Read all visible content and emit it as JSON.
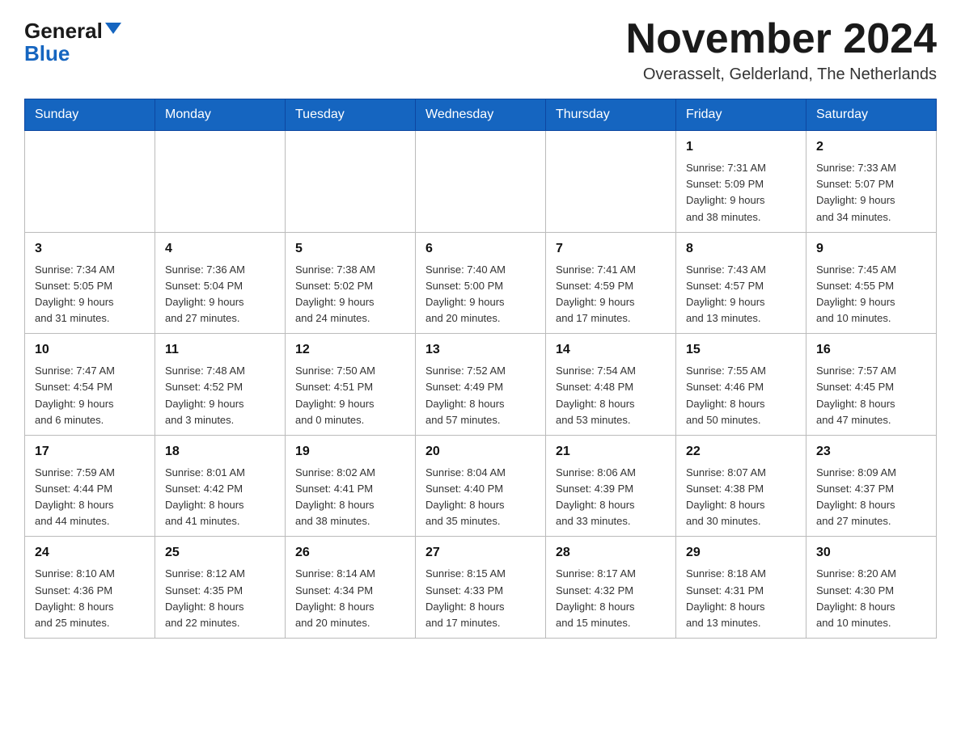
{
  "header": {
    "logo_general": "General",
    "logo_blue": "Blue",
    "month_title": "November 2024",
    "location": "Overasselt, Gelderland, The Netherlands"
  },
  "weekdays": [
    "Sunday",
    "Monday",
    "Tuesday",
    "Wednesday",
    "Thursday",
    "Friday",
    "Saturday"
  ],
  "weeks": [
    [
      {
        "day": "",
        "info": ""
      },
      {
        "day": "",
        "info": ""
      },
      {
        "day": "",
        "info": ""
      },
      {
        "day": "",
        "info": ""
      },
      {
        "day": "",
        "info": ""
      },
      {
        "day": "1",
        "info": "Sunrise: 7:31 AM\nSunset: 5:09 PM\nDaylight: 9 hours\nand 38 minutes."
      },
      {
        "day": "2",
        "info": "Sunrise: 7:33 AM\nSunset: 5:07 PM\nDaylight: 9 hours\nand 34 minutes."
      }
    ],
    [
      {
        "day": "3",
        "info": "Sunrise: 7:34 AM\nSunset: 5:05 PM\nDaylight: 9 hours\nand 31 minutes."
      },
      {
        "day": "4",
        "info": "Sunrise: 7:36 AM\nSunset: 5:04 PM\nDaylight: 9 hours\nand 27 minutes."
      },
      {
        "day": "5",
        "info": "Sunrise: 7:38 AM\nSunset: 5:02 PM\nDaylight: 9 hours\nand 24 minutes."
      },
      {
        "day": "6",
        "info": "Sunrise: 7:40 AM\nSunset: 5:00 PM\nDaylight: 9 hours\nand 20 minutes."
      },
      {
        "day": "7",
        "info": "Sunrise: 7:41 AM\nSunset: 4:59 PM\nDaylight: 9 hours\nand 17 minutes."
      },
      {
        "day": "8",
        "info": "Sunrise: 7:43 AM\nSunset: 4:57 PM\nDaylight: 9 hours\nand 13 minutes."
      },
      {
        "day": "9",
        "info": "Sunrise: 7:45 AM\nSunset: 4:55 PM\nDaylight: 9 hours\nand 10 minutes."
      }
    ],
    [
      {
        "day": "10",
        "info": "Sunrise: 7:47 AM\nSunset: 4:54 PM\nDaylight: 9 hours\nand 6 minutes."
      },
      {
        "day": "11",
        "info": "Sunrise: 7:48 AM\nSunset: 4:52 PM\nDaylight: 9 hours\nand 3 minutes."
      },
      {
        "day": "12",
        "info": "Sunrise: 7:50 AM\nSunset: 4:51 PM\nDaylight: 9 hours\nand 0 minutes."
      },
      {
        "day": "13",
        "info": "Sunrise: 7:52 AM\nSunset: 4:49 PM\nDaylight: 8 hours\nand 57 minutes."
      },
      {
        "day": "14",
        "info": "Sunrise: 7:54 AM\nSunset: 4:48 PM\nDaylight: 8 hours\nand 53 minutes."
      },
      {
        "day": "15",
        "info": "Sunrise: 7:55 AM\nSunset: 4:46 PM\nDaylight: 8 hours\nand 50 minutes."
      },
      {
        "day": "16",
        "info": "Sunrise: 7:57 AM\nSunset: 4:45 PM\nDaylight: 8 hours\nand 47 minutes."
      }
    ],
    [
      {
        "day": "17",
        "info": "Sunrise: 7:59 AM\nSunset: 4:44 PM\nDaylight: 8 hours\nand 44 minutes."
      },
      {
        "day": "18",
        "info": "Sunrise: 8:01 AM\nSunset: 4:42 PM\nDaylight: 8 hours\nand 41 minutes."
      },
      {
        "day": "19",
        "info": "Sunrise: 8:02 AM\nSunset: 4:41 PM\nDaylight: 8 hours\nand 38 minutes."
      },
      {
        "day": "20",
        "info": "Sunrise: 8:04 AM\nSunset: 4:40 PM\nDaylight: 8 hours\nand 35 minutes."
      },
      {
        "day": "21",
        "info": "Sunrise: 8:06 AM\nSunset: 4:39 PM\nDaylight: 8 hours\nand 33 minutes."
      },
      {
        "day": "22",
        "info": "Sunrise: 8:07 AM\nSunset: 4:38 PM\nDaylight: 8 hours\nand 30 minutes."
      },
      {
        "day": "23",
        "info": "Sunrise: 8:09 AM\nSunset: 4:37 PM\nDaylight: 8 hours\nand 27 minutes."
      }
    ],
    [
      {
        "day": "24",
        "info": "Sunrise: 8:10 AM\nSunset: 4:36 PM\nDaylight: 8 hours\nand 25 minutes."
      },
      {
        "day": "25",
        "info": "Sunrise: 8:12 AM\nSunset: 4:35 PM\nDaylight: 8 hours\nand 22 minutes."
      },
      {
        "day": "26",
        "info": "Sunrise: 8:14 AM\nSunset: 4:34 PM\nDaylight: 8 hours\nand 20 minutes."
      },
      {
        "day": "27",
        "info": "Sunrise: 8:15 AM\nSunset: 4:33 PM\nDaylight: 8 hours\nand 17 minutes."
      },
      {
        "day": "28",
        "info": "Sunrise: 8:17 AM\nSunset: 4:32 PM\nDaylight: 8 hours\nand 15 minutes."
      },
      {
        "day": "29",
        "info": "Sunrise: 8:18 AM\nSunset: 4:31 PM\nDaylight: 8 hours\nand 13 minutes."
      },
      {
        "day": "30",
        "info": "Sunrise: 8:20 AM\nSunset: 4:30 PM\nDaylight: 8 hours\nand 10 minutes."
      }
    ]
  ],
  "colors": {
    "header_bg": "#1565c0",
    "header_text": "#ffffff",
    "border": "#999999",
    "logo_blue": "#1565c0"
  }
}
